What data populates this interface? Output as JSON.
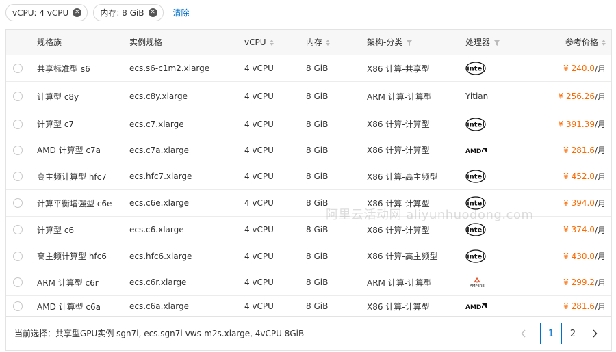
{
  "filters": {
    "chips": [
      {
        "label": "vCPU: 4 vCPU"
      },
      {
        "label": "内存: 8 GiB"
      }
    ],
    "clear_label": "清除"
  },
  "table": {
    "headers": {
      "family": "规格族",
      "spec": "实例规格",
      "vcpu": "vCPU",
      "memory": "内存",
      "arch": "架构-分类",
      "processor": "处理器",
      "price": "参考价格"
    },
    "rows": [
      {
        "family": "共享标准型 s6",
        "spec": "ecs.s6-c1m2.xlarge",
        "vcpu": "4 vCPU",
        "memory": "8 GiB",
        "arch": "X86 计算-共享型",
        "processor": "intel",
        "price": "¥ 240.0",
        "unit": "/月"
      },
      {
        "family": "计算型 c8y",
        "spec": "ecs.c8y.xlarge",
        "vcpu": "4 vCPU",
        "memory": "8 GiB",
        "arch": "ARM 计算-计算型",
        "processor": "Yitian",
        "price": "¥ 256.26",
        "unit": "/月"
      },
      {
        "family": "计算型 c7",
        "spec": "ecs.c7.xlarge",
        "vcpu": "4 vCPU",
        "memory": "8 GiB",
        "arch": "X86 计算-计算型",
        "processor": "intel",
        "price": "¥ 391.39",
        "unit": "/月"
      },
      {
        "family": "AMD 计算型 c7a",
        "spec": "ecs.c7a.xlarge",
        "vcpu": "4 vCPU",
        "memory": "8 GiB",
        "arch": "X86 计算-计算型",
        "processor": "amd",
        "price": "¥ 281.6",
        "unit": "/月"
      },
      {
        "family": "高主频计算型 hfc7",
        "spec": "ecs.hfc7.xlarge",
        "vcpu": "4 vCPU",
        "memory": "8 GiB",
        "arch": "X86 计算-高主频型",
        "processor": "intel",
        "price": "¥ 452.0",
        "unit": "/月"
      },
      {
        "family": "计算平衡增强型 c6e",
        "spec": "ecs.c6e.xlarge",
        "vcpu": "4 vCPU",
        "memory": "8 GiB",
        "arch": "X86 计算-计算型",
        "processor": "intel",
        "price": "¥ 394.0",
        "unit": "/月"
      },
      {
        "family": "计算型 c6",
        "spec": "ecs.c6.xlarge",
        "vcpu": "4 vCPU",
        "memory": "8 GiB",
        "arch": "X86 计算-计算型",
        "processor": "intel",
        "price": "¥ 374.0",
        "unit": "/月"
      },
      {
        "family": "高主频计算型 hfc6",
        "spec": "ecs.hfc6.xlarge",
        "vcpu": "4 vCPU",
        "memory": "8 GiB",
        "arch": "X86 计算-高主频型",
        "processor": "intel",
        "price": "¥ 430.0",
        "unit": "/月"
      },
      {
        "family": "ARM 计算型 c6r",
        "spec": "ecs.c6r.xlarge",
        "vcpu": "4 vCPU",
        "memory": "8 GiB",
        "arch": "ARM 计算-计算型",
        "processor": "ampere",
        "price": "¥ 299.2",
        "unit": "/月"
      },
      {
        "family": "AMD 计算型 c6a",
        "spec": "ecs.c6a.xlarge",
        "vcpu": "4 vCPU",
        "memory": "8 GiB",
        "arch": "X86 计算-计算型",
        "processor": "amd",
        "price": "¥ 281.6",
        "unit": "/月"
      }
    ],
    "logo_text": {
      "intel": "intel",
      "amd": "AMD",
      "ampere": "AMPERE"
    }
  },
  "watermark": "阿里云活动网 aliyunhuodong.com",
  "footer": {
    "selection_text": "当前选择：共享型GPU实例 sgn7i, ecs.sgn7i-vws-m2s.xlarge, 4vCPU 8GiB",
    "pages": [
      "1",
      "2"
    ],
    "current_page": "1"
  },
  "colors": {
    "price": "#ff6a00",
    "link": "#0070cc",
    "active_page_border": "#0070cc"
  }
}
